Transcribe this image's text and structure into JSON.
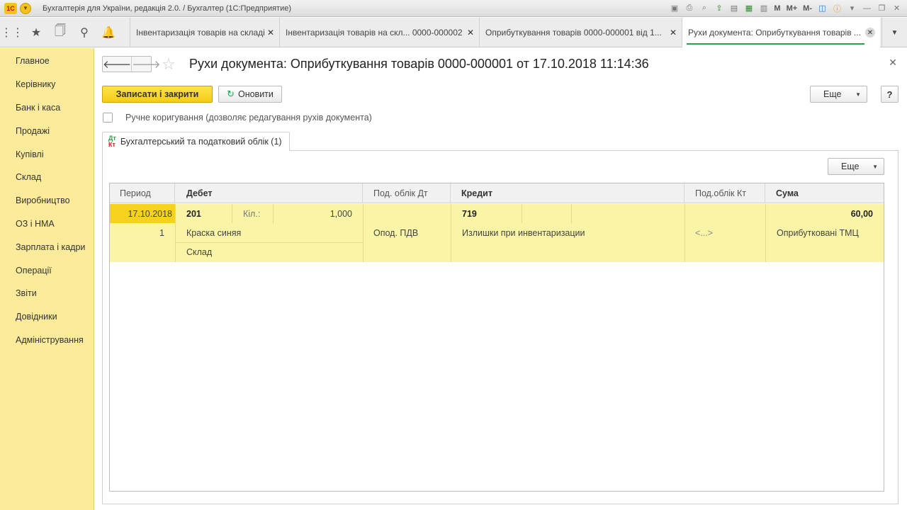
{
  "titlebar": {
    "app_title": "Бухгалтерія для України, редакція 2.0. / Бухгалтер  (1С:Предприятие)",
    "tools": [
      "save-icon",
      "print-icon",
      "preview-icon",
      "upload-icon",
      "doc-icon",
      "calc-icon",
      "calendar-icon"
    ],
    "mem_labels": [
      "M",
      "M+",
      "M-"
    ]
  },
  "tabs": [
    {
      "label": "Інвентаризація товарів на складі"
    },
    {
      "label": "Інвентаризація товарів на скл...  0000-000002"
    },
    {
      "label": "Оприбуткування товарів 0000-000001 від 1..."
    },
    {
      "label": "Рухи документа: Оприбуткування товарів ..."
    }
  ],
  "sidebar": {
    "items": [
      {
        "label": "Главное"
      },
      {
        "label": "Керівнику"
      },
      {
        "label": "Банк і каса"
      },
      {
        "label": "Продажі"
      },
      {
        "label": "Купівлі"
      },
      {
        "label": "Склад"
      },
      {
        "label": "Виробництво"
      },
      {
        "label": "ОЗ і НМА"
      },
      {
        "label": "Зарплата і кадри"
      },
      {
        "label": "Операції"
      },
      {
        "label": "Звіти"
      },
      {
        "label": "Довідники"
      },
      {
        "label": "Адміністрування"
      }
    ]
  },
  "form": {
    "title": "Рухи документа: Оприбуткування товарів 0000-000001 от 17.10.2018 11:14:36",
    "save_close_label": "Записати і закрити",
    "refresh_label": "Оновити",
    "more_label": "Еще",
    "help_label": "?",
    "manual_edit_label": "Ручне коригування (дозволяє редагування рухів документа)",
    "subtab_label": "Бухгалтерський та податковий облік (1)",
    "subtab_icon": {
      "dt": "Дт",
      "kt": "Кт"
    }
  },
  "table": {
    "headers": {
      "period": "Период",
      "debit": "Дебет",
      "tax_dt": "Под. облік Дт",
      "credit": "Кредит",
      "tax_kt": "Под.облік Кт",
      "sum": "Сума"
    },
    "row": {
      "period": "17.10.2018",
      "line_no": "1",
      "debit_account": "201",
      "qty_label": "Кіл.:",
      "qty_value": "1,000",
      "debit_sub1": "Краска синяя",
      "debit_sub2": "Склад",
      "tax_dt_value": "Опод. ПДВ",
      "credit_account": "719",
      "credit_sub1": "Излишки при инвентаризации",
      "tax_kt_value": "<...>",
      "sum_value": "60,00",
      "sum_desc": "Оприбутковані ТМЦ"
    }
  },
  "colors": {
    "sidebar_bg": "#fbeb9a",
    "primary_button": "#f4cd14",
    "row_highlight": "#faf4a6",
    "selected_cell": "#f6d21e",
    "active_tab_underline": "#2e9e4f"
  }
}
